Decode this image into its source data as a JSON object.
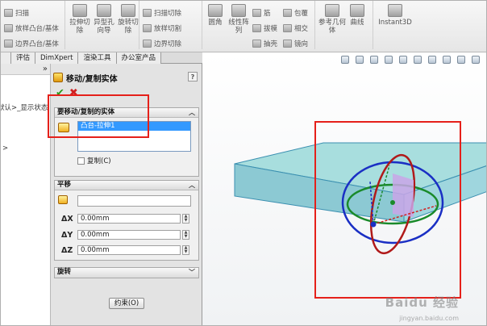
{
  "ribbon": {
    "col1": [
      "扫描",
      "放样凸台/基体",
      "边界凸台/基体"
    ],
    "big_buttons": [
      "拉伸切除",
      "异型孔向导",
      "旋转切除"
    ],
    "col2": [
      "扫描切除",
      "放样切割",
      "边界切除"
    ],
    "col3_big": [
      "圆角",
      "线性阵列"
    ],
    "col4": [
      "筋",
      "拔模",
      "抽壳"
    ],
    "col5": [
      "包覆",
      "相交",
      "镜向"
    ],
    "ref_geom": "参考几何体",
    "curves": "曲线",
    "instant3d": "Instant3D"
  },
  "tabs": [
    "",
    "评估",
    "DimXpert",
    "渲染工具",
    "办公室产品"
  ],
  "tree": {
    "collapse": "»",
    "line1": "默认>_显示状态",
    "line2": ">"
  },
  "pm": {
    "title": "移动/复制实体",
    "help": "?",
    "ok": "✔",
    "cancel": "✖",
    "group_bodies": "要移动/复制的实体",
    "selected_item": "凸台-拉伸1",
    "copy_label": "复制(C)",
    "group_translate": "平移",
    "dx_label": "ΔX",
    "dy_label": "ΔY",
    "dz_label": "ΔZ",
    "dx": "0.00mm",
    "dy": "0.00mm",
    "dz": "0.00mm",
    "group_rotate": "旋转",
    "constraints_button": "约束(O)"
  },
  "watermark": "Baidu 经验",
  "watermark_url": "jingyan.baidu.com",
  "colors": {
    "highlight_red": "#e5201a",
    "selection_blue": "#3399ff",
    "body_cyan": "#9ed8d8",
    "ring_blue": "#1a2fc4",
    "ring_green": "#1a8a2a",
    "ring_red": "#b01a1a"
  }
}
